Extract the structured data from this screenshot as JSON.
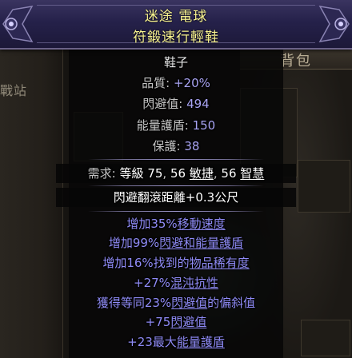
{
  "background": {
    "stash_label": "戰站",
    "inventory_label": "背包"
  },
  "item": {
    "name": "迷途 電球",
    "base": "符鍛速行輕鞋",
    "item_class": "鞋子",
    "properties": [
      {
        "label": "品質",
        "value": "+20%"
      },
      {
        "label": "閃避值",
        "value": "494"
      },
      {
        "label": "能量護盾",
        "value": "150"
      },
      {
        "label": "保護",
        "value": "38"
      }
    ],
    "requirements": {
      "label": "需求:",
      "level_label": "等級",
      "level": "75",
      "dex": "56",
      "dex_label": "敏捷",
      "int": "56",
      "int_label": "智慧"
    },
    "implicit": "閃避翻滾距離+0.3公尺",
    "mods": [
      {
        "pre": "增加35%",
        "term": "移動速度",
        "post": ""
      },
      {
        "pre": "增加99%",
        "term": "閃避和能量護盾",
        "post": ""
      },
      {
        "pre": "增加16%找到的",
        "term": "物品稀有度",
        "post": ""
      },
      {
        "pre": "+27%",
        "term": "混沌抗性",
        "post": ""
      },
      {
        "pre": "獲得等同23%",
        "term": "閃避值",
        "post": "的偏斜值"
      },
      {
        "pre": "+75",
        "term": "閃避值",
        "post": ""
      },
      {
        "pre": "+23最大",
        "term": "能量護盾",
        "post": ""
      }
    ]
  },
  "colors": {
    "name": "#f7f28f",
    "value": "#a8a3f2",
    "mod": "#8f8bf6"
  }
}
